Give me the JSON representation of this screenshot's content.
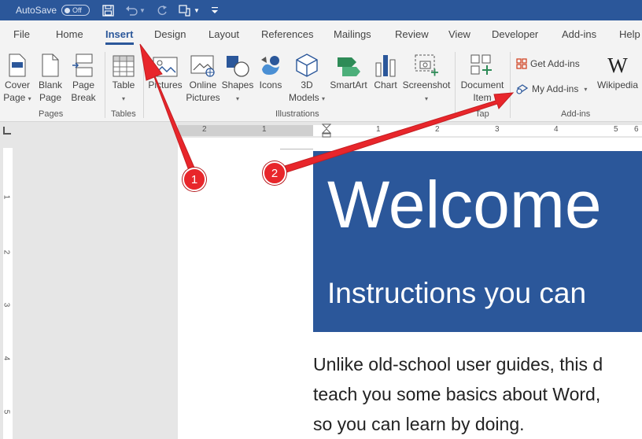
{
  "titlebar": {
    "autosave_label": "AutoSave",
    "autosave_state": "Off"
  },
  "tabs": [
    {
      "label": "File"
    },
    {
      "label": "Home"
    },
    {
      "label": "Insert"
    },
    {
      "label": "Design"
    },
    {
      "label": "Layout"
    },
    {
      "label": "References"
    },
    {
      "label": "Mailings"
    },
    {
      "label": "Review"
    },
    {
      "label": "View"
    },
    {
      "label": "Developer"
    },
    {
      "label": "Add-ins"
    },
    {
      "label": "Help"
    }
  ],
  "ribbon": {
    "cover_page": [
      "Cover",
      "Page"
    ],
    "blank_page": [
      "Blank",
      "Page"
    ],
    "page_break": [
      "Page",
      "Break"
    ],
    "table": "Table",
    "pictures": "Pictures",
    "online_pictures": [
      "Online",
      "Pictures"
    ],
    "shapes": "Shapes",
    "icons": "Icons",
    "models_3d": [
      "3D",
      "Models"
    ],
    "smartart": "SmartArt",
    "chart": "Chart",
    "screenshot": "Screenshot",
    "document_item": [
      "Document",
      "Item"
    ],
    "get_addins": "Get Add-ins",
    "my_addins": "My Add-ins",
    "wikipedia": "Wikipedia",
    "groups": {
      "pages": "Pages",
      "tables": "Tables",
      "illustrations": "Illustrations",
      "tap": "Tap",
      "addins": "Add-ins"
    }
  },
  "ruler": {
    "numbers": [
      "2",
      "1",
      "1",
      "2",
      "3",
      "4",
      "5",
      "6"
    ]
  },
  "vruler": {
    "numbers": [
      "1",
      "2",
      "3",
      "4",
      "5"
    ]
  },
  "document": {
    "banner_title": "Welcome",
    "banner_subtitle": "Instructions you can",
    "body_lines": [
      "Unlike old-school user guides, this d",
      "teach you some basics about Word,",
      "so you can learn by doing."
    ]
  },
  "annotations": {
    "badge1": "1",
    "badge2": "2",
    "arrow_color": "#e8262b"
  },
  "colors": {
    "word_blue": "#2b579a",
    "ribbon_bg": "#f3f3f3"
  }
}
